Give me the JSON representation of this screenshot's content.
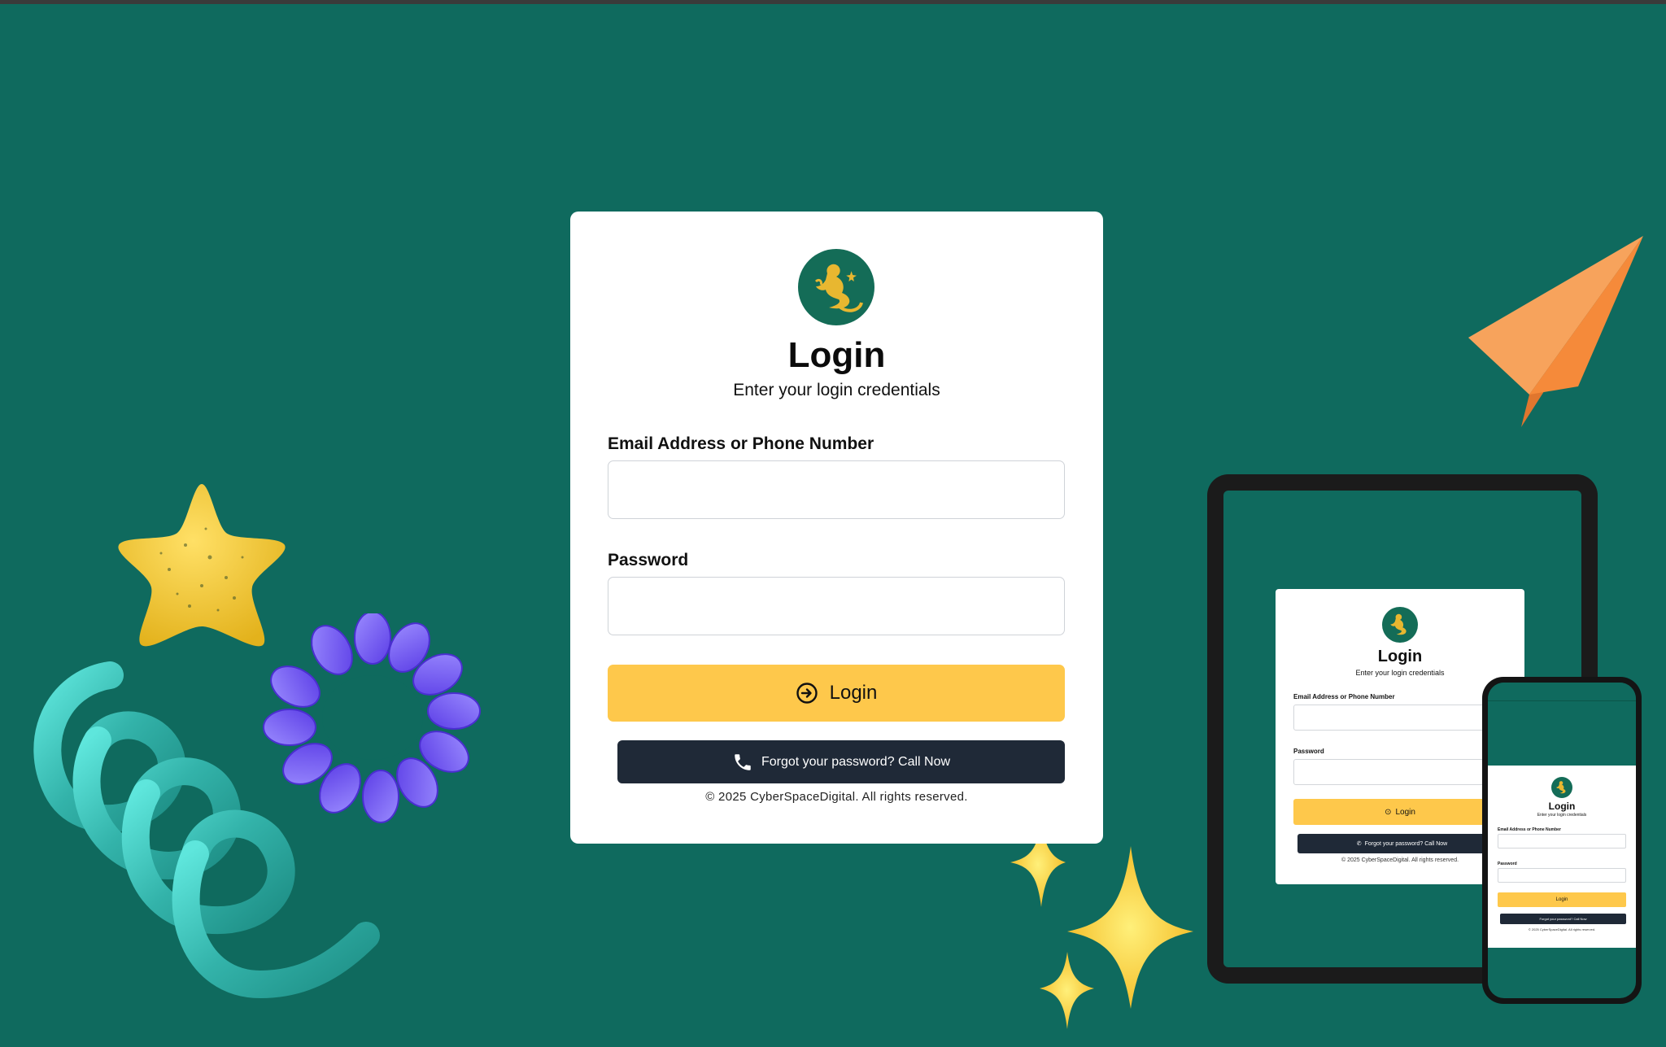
{
  "login": {
    "title": "Login",
    "subtitle": "Enter your login credentials",
    "email_label": "Email Address or Phone Number",
    "email_value": "",
    "password_label": "Password",
    "password_value": "",
    "login_button": "Login",
    "forgot_button": "Forgot your password? Call Now",
    "footer": "© 2025 CyberSpaceDigital. All rights reserved."
  },
  "colors": {
    "background": "#0f6a5e",
    "card": "#ffffff",
    "login_button": "#fec84b",
    "forgot_button": "#1f2937",
    "logo_circle": "#146c57",
    "logo_figure": "#e8b730"
  },
  "icons": {
    "login": "login-arrow-icon",
    "forgot": "phone-icon",
    "logo": "genie-logo-icon"
  }
}
